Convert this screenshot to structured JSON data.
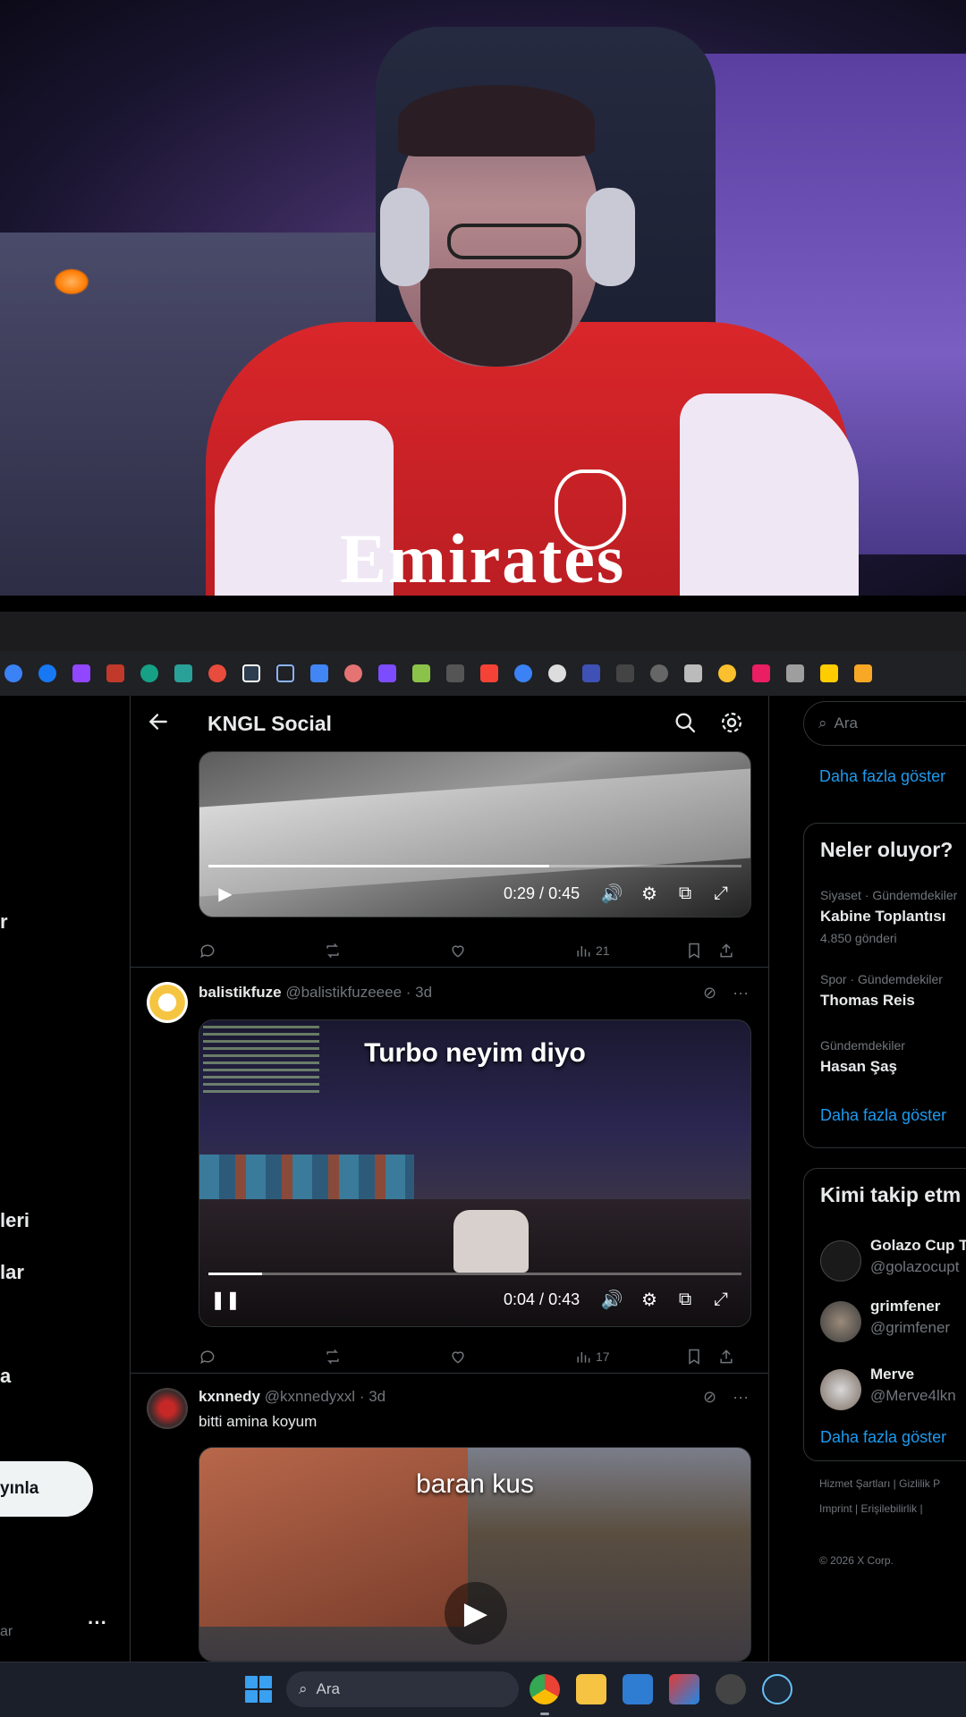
{
  "top_bar": {
    "title": "KNGL Social"
  },
  "left_nav_fragments": [
    "r",
    "leri",
    "lar",
    "a"
  ],
  "post_button_label": "yınla",
  "profile_fragment": "ar",
  "posts": [
    {
      "video": {
        "current": "0:29",
        "duration": "0:45",
        "progress": 0.64
      },
      "actions": {
        "views": "21"
      }
    },
    {
      "author": {
        "name": "balistikfuze",
        "handle": "@balistikfuzeeee",
        "time": "· 3d"
      },
      "video": {
        "caption": "Turbo neyim diyo",
        "current": "0:04",
        "duration": "0:43",
        "progress": 0.1
      },
      "actions": {
        "views": "17"
      }
    },
    {
      "author": {
        "name": "kxnnedy",
        "handle": "@kxnnedyxxl",
        "time": "· 3d"
      },
      "text": "bitti amina koyum",
      "video": {
        "caption": "baran kus"
      }
    }
  ],
  "right": {
    "search_placeholder": "Ara",
    "show_more": "Daha fazla göster",
    "trends": {
      "title": "Neler oluyor?",
      "items": [
        {
          "category": "Siyaset · Gündemdekiler",
          "name": "Kabine Toplantısı",
          "count": "4.850 gönderi"
        },
        {
          "category": "Spor · Gündemdekiler",
          "name": "Thomas Reis"
        },
        {
          "category": "Gündemdekiler",
          "name": "Hasan Şaş"
        }
      ]
    },
    "follow": {
      "title": "Kimi takip etm",
      "items": [
        {
          "name": "Golazo Cup T",
          "handle": "@golazocupt"
        },
        {
          "name": "grimfener",
          "handle": "@grimfener"
        },
        {
          "name": "Merve",
          "handle": "@Merve4lkn"
        }
      ]
    },
    "footer": {
      "line1": "Hizmet Şartları  |  Gizlilik P",
      "line2": "Imprint  |  Erişilebilirlik  |",
      "line3": "© 2026 X Corp."
    }
  },
  "taskbar": {
    "search_label": "Ara"
  },
  "webcam": {
    "sponsor_text": "Emirates"
  },
  "colors": {
    "accent": "#1d9bf0",
    "background": "#000000",
    "border": "#2f3336",
    "muted": "#71767b"
  }
}
